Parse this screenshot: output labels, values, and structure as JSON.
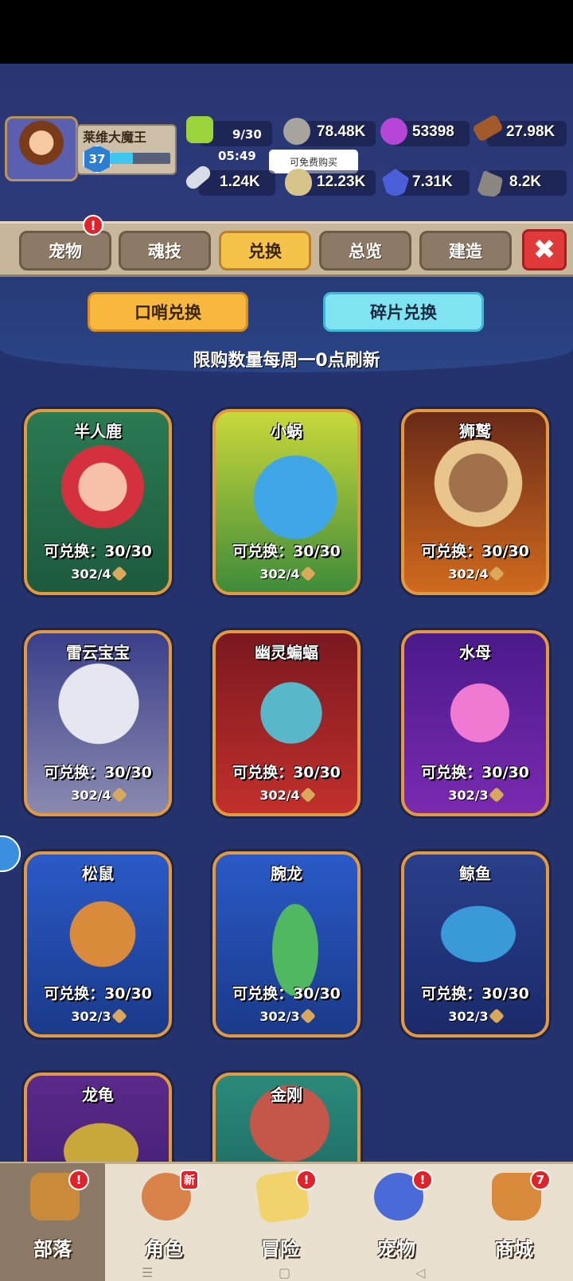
{
  "player": {
    "name": "莱维大魔王",
    "level": "37",
    "xp_fraction": 0.38
  },
  "resources": {
    "stamina": "9/30",
    "timer": "05:49",
    "stone": "78.48K",
    "gem": "53398",
    "wood": "27.98K",
    "bone": "1.24K",
    "egg": "12.23K",
    "crystal": "7.31K",
    "ore": "8.2K",
    "tooltip": "可免费购买"
  },
  "tabs": [
    {
      "label": "宠物",
      "alert": "!"
    },
    {
      "label": "魂技"
    },
    {
      "label": "兑换",
      "active": true
    },
    {
      "label": "总览"
    },
    {
      "label": "建造"
    }
  ],
  "close_label": "✖",
  "exchange": {
    "whistle_label": "口哨兑换",
    "fragment_label": "碎片兑换",
    "note": "限购数量每周一0点刷新"
  },
  "cards": [
    {
      "name": "半人鹿",
      "limit": "可兑换：30/30",
      "cost": "302/4"
    },
    {
      "name": "小蜗",
      "limit": "可兑换：30/30",
      "cost": "302/4"
    },
    {
      "name": "狮鹫",
      "limit": "可兑换：30/30",
      "cost": "302/4"
    },
    {
      "name": "雷云宝宝",
      "limit": "可兑换：30/30",
      "cost": "302/4"
    },
    {
      "name": "幽灵蝙蝠",
      "limit": "可兑换：30/30",
      "cost": "302/4"
    },
    {
      "name": "水母",
      "limit": "可兑换：30/30",
      "cost": "302/3"
    },
    {
      "name": "松鼠",
      "limit": "可兑换：30/30",
      "cost": "302/3"
    },
    {
      "name": "腕龙",
      "limit": "可兑换：30/30",
      "cost": "302/3"
    },
    {
      "name": "鲸鱼",
      "limit": "可兑换：30/30",
      "cost": "302/3"
    },
    {
      "name": "龙龟"
    },
    {
      "name": "金刚"
    }
  ],
  "nav": [
    {
      "label": "部落",
      "badge": "!",
      "active": true
    },
    {
      "label": "角色",
      "badge": "新"
    },
    {
      "label": "冒险",
      "badge": "!"
    },
    {
      "label": "宠物",
      "badge": "!"
    },
    {
      "label": "商城",
      "badge": "7"
    }
  ],
  "system_keys": {
    "menu": "☰",
    "home": "▢",
    "back": "◁"
  },
  "colors": {
    "accent": "#f5c24a",
    "alert": "#e0222a",
    "card_border": "#e49a3c",
    "background": "#24336e"
  }
}
